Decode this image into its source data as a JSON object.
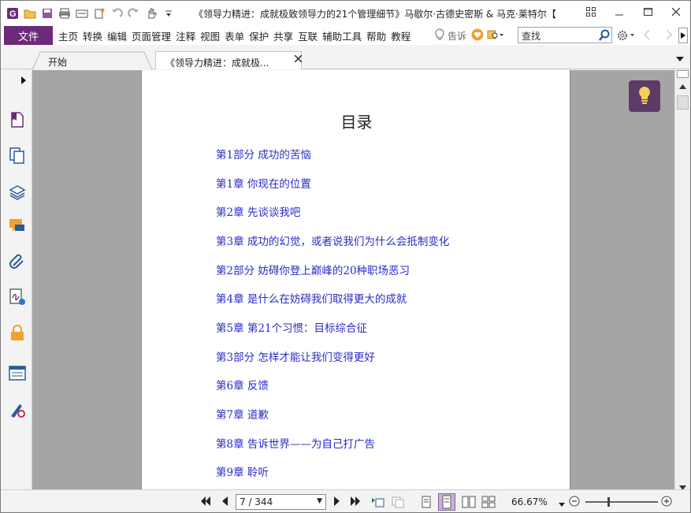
{
  "title_bar": {
    "document_title": "《领导力精进：成就极致领导力的21个管理细节》马歇尔·古德史密斯 & 马克·莱特尔【",
    "quick_access_icons": [
      "app-logo-icon",
      "open-folder-icon",
      "save-icon",
      "print-icon",
      "scan-icon",
      "new-icon",
      "undo-icon",
      "redo-icon",
      "hand-tool-icon",
      "customize-dropdown-icon"
    ],
    "window_buttons": [
      "restore-layout-icon",
      "minimize-icon",
      "maximize-icon",
      "close-icon"
    ]
  },
  "menu_bar": {
    "file_label": "文件",
    "items": [
      "主页",
      "转换",
      "编辑",
      "页面管理",
      "注释",
      "视图",
      "表单",
      "保护",
      "共享",
      "互联",
      "辅助工具",
      "帮助",
      "教程"
    ],
    "tell_me_label": "告诉",
    "search_placeholder": "查找"
  },
  "tabs": [
    {
      "label": "开始"
    },
    {
      "label": "《领导力精进：成就极..."
    }
  ],
  "left_panel_icons": [
    "bookmark-icon",
    "pages-icon",
    "layers-icon",
    "comments-icon",
    "attachments-icon",
    "signature-icon",
    "security-lock-icon",
    "form-fields-icon",
    "certificate-icon"
  ],
  "page": {
    "title": "目录",
    "toc": [
      "第1部分 成功的苦恼",
      "第1章 你现在的位置",
      "第2章 先谈谈我吧",
      "第3章 成功的幻觉，或者说我们为什么会抵制变化",
      "第2部分 妨碍你登上巅峰的20种职场恶习",
      "第4章 是什么在妨碍我们取得更大的成就",
      "第5章 第21个习惯：目标综合征",
      "第3部分 怎样才能让我们变得更好",
      "第6章 反馈",
      "第7章 道歉",
      "第8章 告诉世界——为自己打广告",
      "第9章 聆听"
    ]
  },
  "status_bar": {
    "page_indicator": "7 / 344",
    "zoom": "66.67%"
  },
  "colors": {
    "accent_purple": "#6b2b7a",
    "link_blue": "#2b2bc8",
    "bulb_bg": "#5e3a66"
  }
}
